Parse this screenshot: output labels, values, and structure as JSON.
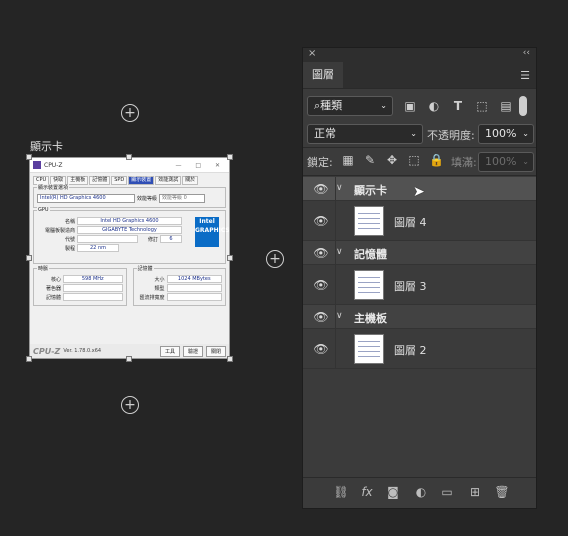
{
  "canvas": {
    "artboard_label": "顯示卡",
    "add_buttons": [
      "+",
      "+",
      "+"
    ]
  },
  "cpuz": {
    "title": "CPU-Z",
    "window_controls": "— □ ✕",
    "tabs": [
      "CPU",
      "快取",
      "主機板",
      "記憶體",
      "SPD",
      "顯示裝置",
      "效能測試",
      "關於"
    ],
    "active_tab": "顯示裝置",
    "device_group": "顯示裝置選項",
    "device_select": "Intel(R) HD Graphics 4600",
    "perf_label": "效能等級",
    "perf_select": "效能等級 0",
    "gpu_group": "GPU",
    "gpu_rows": [
      {
        "label": "名稱",
        "value": "Intel HD Graphics 4600"
      },
      {
        "label": "電腦板製造商",
        "value": "GIGABYTE Technology"
      },
      {
        "label": "代號",
        "value": ""
      },
      {
        "label": "製程",
        "value": "22 nm"
      }
    ],
    "revision_label": "修訂",
    "revision_value": "6",
    "intel_badge": "Intel GRAPHICS",
    "clock_group": "時脈",
    "clock_rows": [
      {
        "label": "核心",
        "value": "598 MHz"
      },
      {
        "label": "著色器",
        "value": ""
      },
      {
        "label": "記憶體",
        "value": ""
      }
    ],
    "memory_group": "記憶體",
    "memory_rows": [
      {
        "label": "大小",
        "value": "1024 MBytes"
      },
      {
        "label": "類型",
        "value": ""
      },
      {
        "label": "匯流排寬度",
        "value": ""
      }
    ],
    "brand": "CPU-Z",
    "version": "Ver. 1.78.0.x64",
    "tools_btn": "工具",
    "validate_btn": "驗證",
    "close_btn": "關閉"
  },
  "panel": {
    "close_glyph": "×",
    "collapse_glyph": "‹‹",
    "tab_label": "圖層",
    "menu_icon": "hamburger-icon",
    "filter_kind": "種類",
    "blend_mode": "正常",
    "opacity_label": "不透明度:",
    "opacity_value": "100%",
    "lock_label": "鎖定:",
    "fill_label": "填滿:",
    "fill_value": "100%",
    "layers": [
      {
        "type": "group",
        "name": "顯示卡",
        "selected": true
      },
      {
        "type": "layer",
        "name": "圖層 4"
      },
      {
        "type": "group",
        "name": "記憶體",
        "selected": false
      },
      {
        "type": "layer",
        "name": "圖層 3"
      },
      {
        "type": "group",
        "name": "主機板",
        "selected": false
      },
      {
        "type": "layer",
        "name": "圖層 2"
      }
    ],
    "bottom_icons": [
      "link-icon",
      "fx-icon",
      "mask-icon",
      "adjustment-icon",
      "folder-icon",
      "new-layer-icon",
      "trash-icon"
    ],
    "fx_label": "fx"
  }
}
